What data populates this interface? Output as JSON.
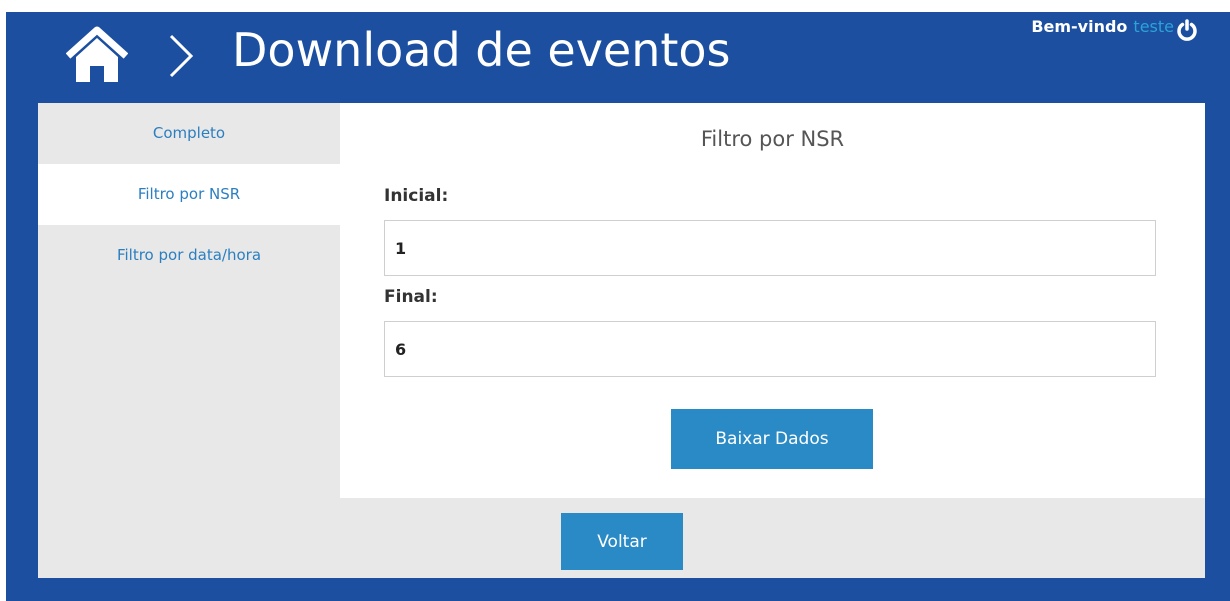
{
  "header": {
    "title": "Download de eventos",
    "welcome_text": "Bem-vindo",
    "username": "teste",
    "home_icon": "home-icon",
    "separator_icon": "chevron-right-icon",
    "power_icon": "power-icon"
  },
  "sidebar": {
    "items": [
      {
        "label": "Completo"
      },
      {
        "label": "Filtro por NSR"
      },
      {
        "label": "Filtro por data/hora"
      }
    ]
  },
  "form": {
    "title": "Filtro por NSR",
    "initial_label": "Inicial:",
    "initial_value": "1",
    "final_label": "Final:",
    "final_value": "6",
    "download_label": "Baixar Dados"
  },
  "footer": {
    "back_label": "Voltar"
  },
  "colors": {
    "frame": "#1c4fa0",
    "accent": "#2a8ac6",
    "link": "#2b7fc0",
    "username": "#2aa3d9",
    "panel": "#e8e8e8"
  }
}
